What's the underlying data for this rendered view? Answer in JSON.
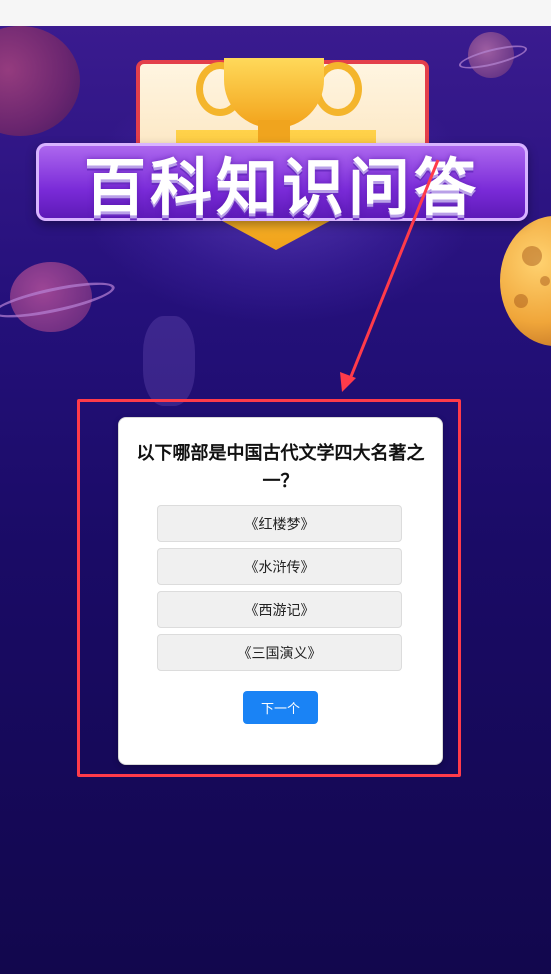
{
  "banner": {
    "title": "百科知识问答"
  },
  "quiz": {
    "question": "以下哪部是中国古代文学四大名著之一？",
    "options": [
      "《红楼梦》",
      "《水浒传》",
      "《西游记》",
      "《三国演义》"
    ],
    "next_label": "下一个"
  },
  "colors": {
    "annotation": "#ff3b4a",
    "next_button": "#1a83f5",
    "background_top": "#3a1b8f",
    "background_bottom": "#12074d"
  }
}
